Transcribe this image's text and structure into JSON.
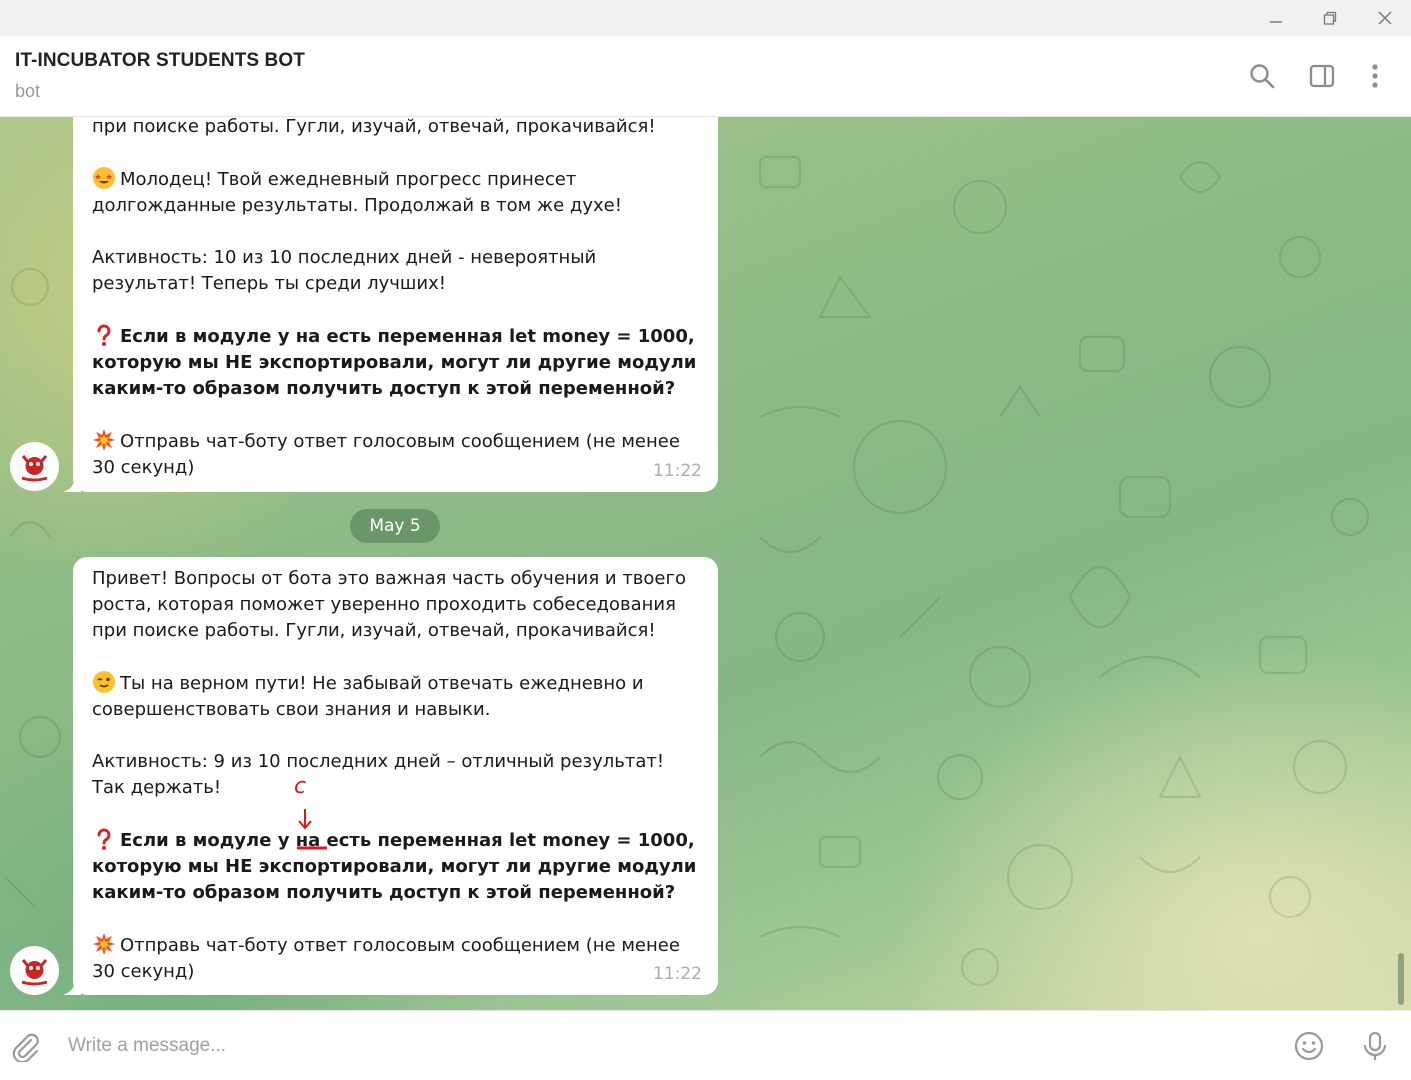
{
  "window": {
    "minimize_icon": "minimize-icon",
    "restore_icon": "restore-icon",
    "close_icon": "close-icon"
  },
  "header": {
    "title": "IT-INCUBATOR STUDENTS BOT",
    "subtitle": "bot",
    "icons": [
      "search-icon",
      "sidebar-toggle-icon",
      "more-vertical-icon"
    ]
  },
  "messages": [
    {
      "partial_top_line": "при поиске работы. Гугли, изучай, отвечай, прокачивайся!",
      "praise_emoji": "star-struck-emoji",
      "praise": "Молодец! Твой ежедневный прогресс принесет долгожданные результаты. Продолжай в том же духе!",
      "activity_prefix": "Активность: ",
      "activity_count": "10",
      "activity_middle": " из ",
      "activity_total": "10",
      "activity_suffix": " последних дней - невероятный результат! Теперь ты среди лучших!",
      "question_emoji": "red-question-mark-emoji",
      "question": "Если в модуле у на есть переменная let money = 1000, которую мы НЕ экспортировали, могут ли другие модули каким-то образом получить доступ к этой переменной?",
      "task_emoji": "collision-emoji",
      "task": "Отправь чат-боту ответ голосовым сообщением (не менее 30 секунд)",
      "time": "11:22"
    },
    {
      "intro": "Привет! Вопросы от бота это важная часть обучения и твоего роста, которая поможет уверенно проходить собеседования при поиске работы. Гугли, изучай, отвечай, прокачивайся!",
      "praise_emoji": "winking-face-emoji",
      "praise": "Ты на верном пути! Не забывай отвечать ежедневно и совершенствовать свои знания и навыки.",
      "activity_prefix": "Активность: ",
      "activity_count": "9",
      "activity_middle": " из ",
      "activity_total": "10",
      "activity_suffix": " последних дней – отличный результат! Так держать!",
      "question_emoji": "red-question-mark-emoji",
      "question_before": "Если в модуле у на",
      "question_after": " есть переменная let money = 1000, которую мы НЕ экспортировали, могут ли другие модули каким-то образом получить доступ к этой переменной?",
      "annotation_letter": "с",
      "task_emoji": "collision-emoji",
      "task": "Отправь чат-боту ответ голосовым сообщением (не менее 30 секунд)",
      "time": "11:22"
    }
  ],
  "date_separator": "May 5",
  "composer": {
    "placeholder": "Write a message...",
    "value": "",
    "icons": [
      "attach-icon",
      "emoji-icon",
      "microphone-icon"
    ]
  },
  "colors": {
    "annotation_red": "#e0161b",
    "date_pill": "#5f8c5f",
    "time_text": "#a6b0a6"
  }
}
